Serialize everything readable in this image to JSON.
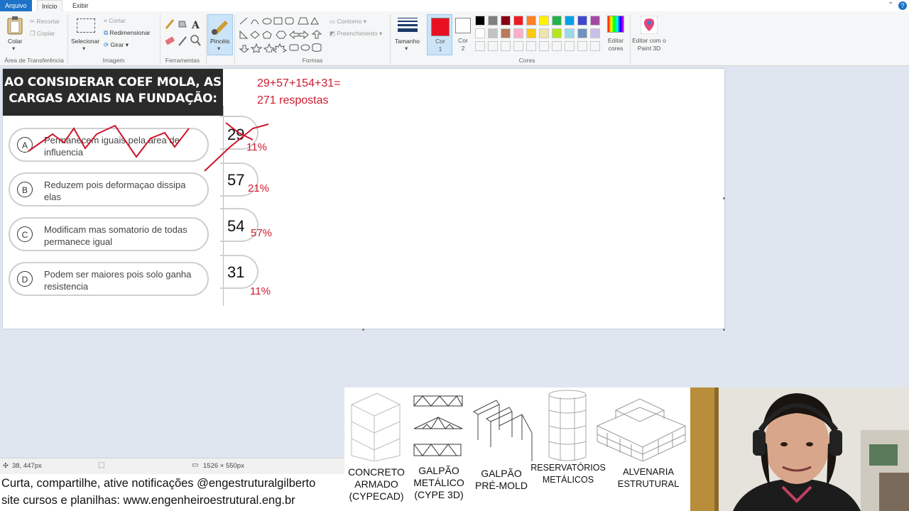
{
  "tabs": {
    "file": "Arquivo",
    "home": "Início",
    "view": "Exibir"
  },
  "clipboard": {
    "paste": "Colar",
    "cut": "Recortar",
    "copy": "Copiar",
    "group": "Área de Transferência"
  },
  "image": {
    "select": "Selecionar",
    "crop": "Cortar",
    "resize": "Redimensionar",
    "rotate": "Girar",
    "group": "Imagem"
  },
  "tools": {
    "group": "Ferramentas"
  },
  "brushes": {
    "label": "Pincéis"
  },
  "shapes": {
    "outline": "Contorno",
    "fill": "Preenchimento",
    "group": "Formas"
  },
  "size": {
    "label": "Tamanho"
  },
  "colors": {
    "color1": "Cor 1",
    "color1_value": "#e81123",
    "color2": "Cor 2",
    "color2_value": "#ffffff",
    "edit": "Editar cores",
    "paint3d": "Editar com o Paint 3D",
    "group": "Cores",
    "palette_row1": [
      "#000000",
      "#7f7f7f",
      "#880015",
      "#ed1c24",
      "#ff7f27",
      "#fff200",
      "#22b14c",
      "#00a2e8",
      "#3f48cc",
      "#a349a4"
    ],
    "palette_row2": [
      "#ffffff",
      "#c3c3c3",
      "#b97a57",
      "#ffaec9",
      "#ffc90e",
      "#efe4b0",
      "#b5e61d",
      "#99d9ea",
      "#7092be",
      "#c8bfe7"
    ]
  },
  "quiz": {
    "title_line1": "AO CONSIDERAR COEF MOLA, AS",
    "title_line2": "CARGAS AXIAIS NA FUNDAÇÃO:",
    "options": [
      {
        "letter": "A",
        "text": "Permanecem iguais pela area de influencia",
        "count": "29",
        "pct": "11%"
      },
      {
        "letter": "B",
        "text": "Reduzem pois deformaçao dissipa elas",
        "count": "57",
        "pct": "21%"
      },
      {
        "letter": "C",
        "text": "Modificam mas somatorio de todas permanece igual",
        "count": "54",
        "pct": "57%"
      },
      {
        "letter": "D",
        "text": "Podem ser maiores pois solo ganha resistencia",
        "count": "31",
        "pct": "11%"
      }
    ]
  },
  "annotation": {
    "line1": "29+57+154+31=",
    "line2": "271 respostas"
  },
  "status": {
    "cursor": "38, 447px",
    "size": "1526 × 550px"
  },
  "footer": {
    "line1": "Curta, compartilhe, ative notificações @engestruturalgilberto",
    "line2": "site cursos e planilhas: www.engenheiroestrutural.eng.br"
  },
  "structures": [
    {
      "label": "CONCRETO ARMADO (CYPECAD)"
    },
    {
      "label": "GALPÃO METÁLICO (CYPE 3D)"
    },
    {
      "label": "GALPÃO PRÉ-MOLD"
    },
    {
      "label": "RESERVATÓRIOS METÁLICOS"
    },
    {
      "label": "ALVENARIA ESTRUTURAL"
    }
  ]
}
